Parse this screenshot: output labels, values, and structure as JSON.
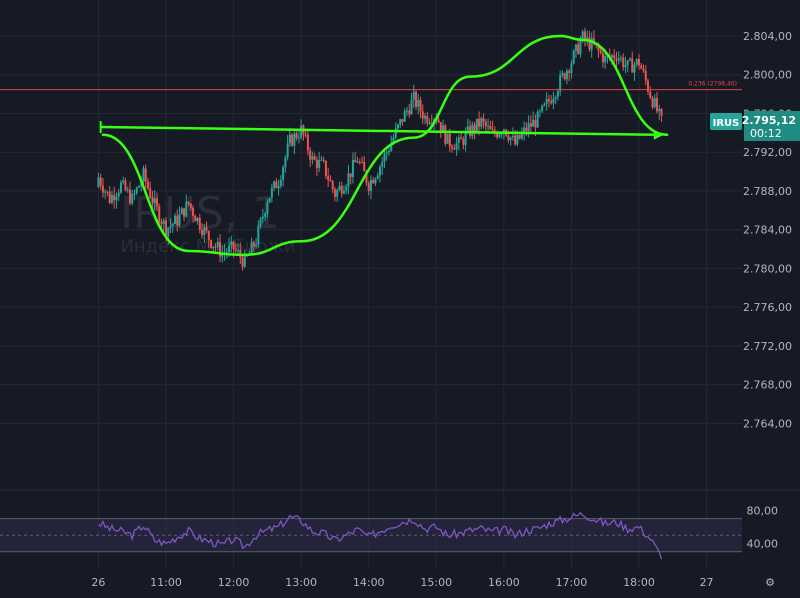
{
  "watermark": {
    "symbol": "IRUS, 1",
    "exchange": "Индекс МосБиржи"
  },
  "price_axis": {
    "ticks": [
      "2.804,00",
      "2.800,00",
      "2.796,00",
      "2.792,00",
      "2.788,00",
      "2.784,00",
      "2.780,00",
      "2.776,00",
      "2.772,00",
      "2.768,00",
      "2.764,00"
    ]
  },
  "rsi_axis": {
    "ticks": [
      "80,00",
      "40,00"
    ]
  },
  "time_axis": {
    "ticks": [
      "26",
      "11:00",
      "12:00",
      "13:00",
      "14:00",
      "15:00",
      "16:00",
      "17:00",
      "18:00",
      "27"
    ]
  },
  "fib_label": "0.236 (2798,46)",
  "ticker_tag": {
    "symbol": "IRUS",
    "price": "2.795,12",
    "countdown": "00:12"
  },
  "colors": {
    "background": "#161a25",
    "grid": "#242833",
    "candle_up": "#26a69a",
    "candle_down": "#ef5350",
    "hline": "#e04545",
    "drawing": "#39ff14",
    "rsi_line": "#7e57c2",
    "rsi_band": "#2d2a4a",
    "axis_text": "#b2b5be",
    "tag_bg": "#26a69a",
    "tag_price_bg": "#1e8c80"
  },
  "chart_data": {
    "type": "candlestick",
    "timeframe": "1",
    "y_range": [
      2761,
      2806
    ],
    "x_range": [
      "09:58",
      "18:59"
    ],
    "hline_level": 2798.46,
    "last_price": 2795.12,
    "rsi_range": [
      20,
      95
    ],
    "rsi_levels": [
      70,
      50,
      30
    ],
    "candles": {
      "times": [
        "10:00",
        "10:10",
        "10:20",
        "10:30",
        "10:40",
        "10:50",
        "11:00",
        "11:10",
        "11:20",
        "11:30",
        "11:40",
        "11:50",
        "12:00",
        "12:10",
        "12:20",
        "12:30",
        "12:40",
        "12:50",
        "13:00",
        "13:10",
        "13:20",
        "13:30",
        "13:40",
        "13:50",
        "14:00",
        "14:10",
        "14:20",
        "14:30",
        "14:40",
        "14:50",
        "15:00",
        "15:10",
        "15:20",
        "15:30",
        "15:40",
        "15:50",
        "16:00",
        "16:10",
        "16:20",
        "16:30",
        "16:40",
        "16:50",
        "17:00",
        "17:10",
        "17:20",
        "17:30",
        "17:40",
        "17:50",
        "18:00",
        "18:10",
        "18:20"
      ],
      "close": [
        2789.4,
        2787.2,
        2788.6,
        2787.1,
        2789.6,
        2786.5,
        2784.1,
        2785.0,
        2786.7,
        2784.6,
        2782.8,
        2781.6,
        2782.1,
        2780.6,
        2782.9,
        2787.2,
        2789.1,
        2793.1,
        2794.3,
        2791.2,
        2790.5,
        2787.7,
        2789.1,
        2791.3,
        2788.7,
        2790.6,
        2793.0,
        2795.5,
        2797.5,
        2795.6,
        2795.8,
        2793.1,
        2792.8,
        2794.2,
        2795.1,
        2793.8,
        2794.6,
        2792.8,
        2794.4,
        2795.4,
        2797.3,
        2799.3,
        2801.4,
        2803.8,
        2802.9,
        2801.6,
        2802.1,
        2800.8,
        2801.3,
        2798.0,
        2795.1
      ],
      "open": [
        2788.4,
        2789.4,
        2787.2,
        2788.6,
        2787.1,
        2789.6,
        2786.5,
        2784.1,
        2785.0,
        2786.7,
        2784.6,
        2782.8,
        2781.6,
        2782.1,
        2780.6,
        2782.9,
        2787.2,
        2789.1,
        2793.1,
        2794.3,
        2791.2,
        2790.5,
        2787.7,
        2789.1,
        2791.3,
        2788.7,
        2790.6,
        2793.0,
        2795.5,
        2797.5,
        2795.6,
        2795.8,
        2793.1,
        2792.8,
        2794.2,
        2795.1,
        2793.8,
        2794.6,
        2792.8,
        2794.4,
        2795.4,
        2797.3,
        2799.3,
        2801.4,
        2803.8,
        2802.9,
        2801.6,
        2802.1,
        2800.8,
        2801.3,
        2798.0
      ]
    },
    "series": [
      {
        "name": "RSI",
        "values": [
          65,
          58,
          55,
          50,
          62,
          44,
          40,
          48,
          55,
          46,
          42,
          38,
          45,
          36,
          50,
          56,
          60,
          72,
          68,
          55,
          52,
          44,
          50,
          57,
          48,
          55,
          62,
          66,
          70,
          58,
          60,
          50,
          52,
          56,
          58,
          54,
          57,
          50,
          56,
          58,
          64,
          68,
          72,
          76,
          70,
          64,
          66,
          58,
          60,
          46,
          24
        ]
      }
    ],
    "drawings": [
      {
        "type": "trend_arrow",
        "from": [
          "10:02",
          2794.6
        ],
        "to": [
          "18:22",
          2793.8
        ]
      },
      {
        "type": "freehand_curve"
      }
    ]
  }
}
